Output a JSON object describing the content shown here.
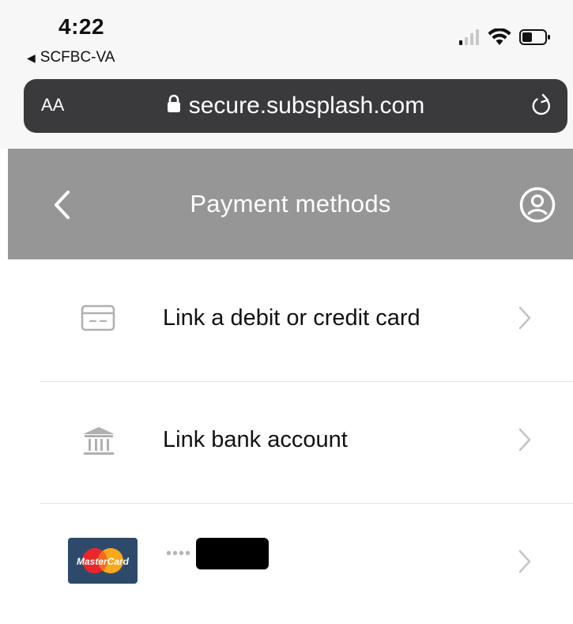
{
  "status_bar": {
    "time": "4:22",
    "back_app": "SCFBC-VA",
    "icons": [
      "cellular-signal-icon",
      "wifi-icon",
      "battery-icon"
    ]
  },
  "url_bar": {
    "text_size_label": "AA",
    "domain": "secure.subsplash.com",
    "icons": [
      "lock-icon",
      "reload-icon"
    ],
    "background_color": "#3a3a3c"
  },
  "header": {
    "title": "Payment methods",
    "background_color": "#969696",
    "icons": [
      "back-chevron-icon",
      "profile-icon"
    ]
  },
  "payment_options": [
    {
      "label": "Link a debit or credit card",
      "icon": "credit-card-icon"
    },
    {
      "label": "Link bank account",
      "icon": "bank-icon"
    },
    {
      "masked_digits": "••••",
      "brand": "MasterCard",
      "icon": "mastercard-logo-icon"
    }
  ]
}
